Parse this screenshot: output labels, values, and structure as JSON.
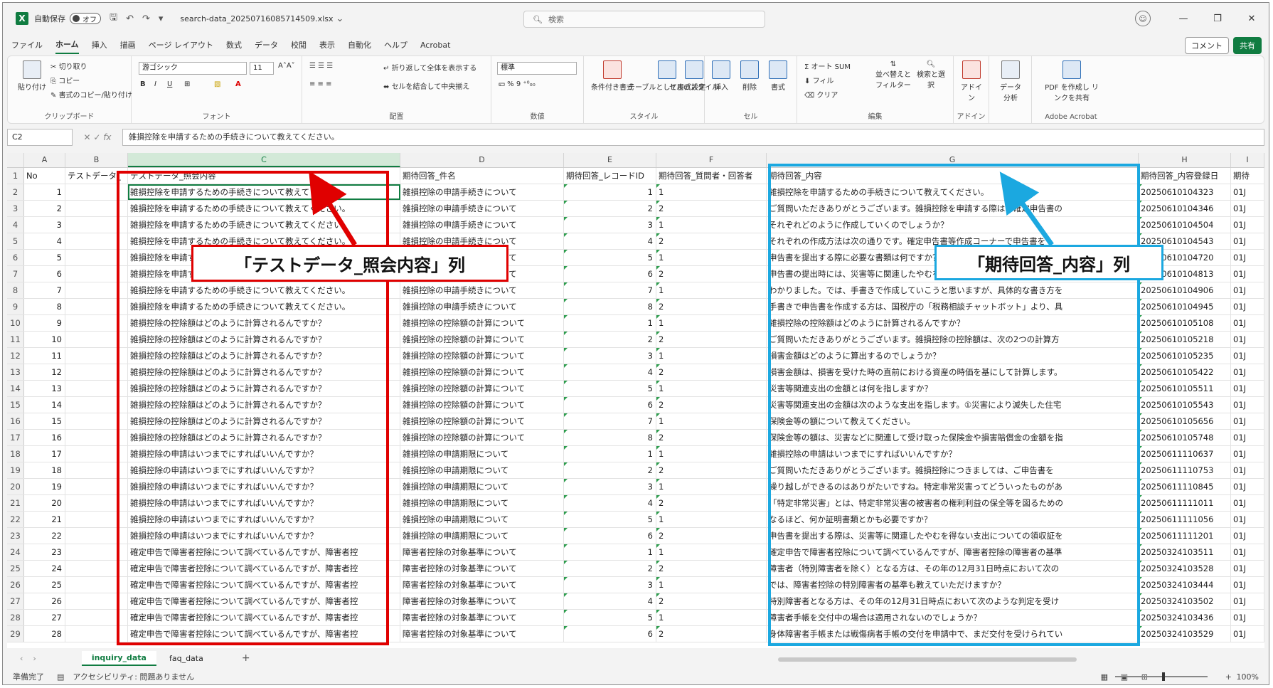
{
  "titlebar": {
    "autosave_label": "自動保存",
    "autosave_state": "オフ",
    "filename": "search-data_20250716085714509.xlsx",
    "search_placeholder": "検索"
  },
  "menu": [
    "ファイル",
    "ホーム",
    "挿入",
    "描画",
    "ページ レイアウト",
    "数式",
    "データ",
    "校閲",
    "表示",
    "自動化",
    "ヘルプ",
    "Acrobat"
  ],
  "menu_active": "ホーム",
  "menu_right": {
    "comment": "コメント",
    "share": "共有"
  },
  "ribbon": {
    "clipboard": {
      "label": "クリップボード",
      "paste": "貼り付け",
      "cut": "切り取り",
      "copy": "コピー",
      "format_painter": "書式のコピー/貼り付け"
    },
    "font": {
      "label": "フォント",
      "name": "游ゴシック",
      "size": "11"
    },
    "alignment": {
      "label": "配置",
      "wrap": "折り返して全体を表示する",
      "merge": "セルを結合して中央揃え"
    },
    "number": {
      "label": "数値",
      "format": "標準"
    },
    "styles": {
      "label": "スタイル",
      "cond": "条件付き書式",
      "table": "テーブルとして書式設定",
      "cell": "セルのスタイル"
    },
    "cells": {
      "label": "セル",
      "insert": "挿入",
      "delete": "削除",
      "format": "書式"
    },
    "editing": {
      "label": "編集",
      "autosum": "オート SUM",
      "fill": "フィル",
      "clear": "クリア",
      "sort": "並べ替えとフィルター",
      "find": "検索と選択"
    },
    "addins": {
      "label": "アドイン",
      "addin": "アドイン"
    },
    "analysis": {
      "label": "",
      "analyze": "データ分析"
    },
    "acrobat": {
      "label": "Adobe Acrobat",
      "pdf": "PDF を作成し リンクを共有"
    }
  },
  "formula_bar": {
    "namebox": "C2",
    "formula": "雑損控除を申請するための手続きについて教えてください。"
  },
  "columns": [
    "A",
    "B",
    "C",
    "D",
    "E",
    "F",
    "G",
    "H",
    "I"
  ],
  "header_row": [
    "No",
    "テストデータ_",
    "テストデータ_照会内容",
    "期待回答_件名",
    "期待回答_レコードID",
    "期待回答_質問者・回答者",
    "期待回答_内容",
    "期待回答_内容登録日",
    "期待"
  ],
  "rows": [
    {
      "no": "1",
      "c": "雑損控除を申請するための手続きについて教えてください。",
      "d": "雑損控除の申請手続きについて",
      "e": "1",
      "f": "1",
      "g": "雑損控除を申請するための手続きについて教えてください。",
      "h": "20250610104323",
      "i": "01J"
    },
    {
      "no": "2",
      "c": "雑損控除を申請するための手続きについて教えてください。",
      "d": "雑損控除の申請手続きについて",
      "e": "2",
      "f": "2",
      "g": "ご質問いただきありがとうございます。雑損控除を申請する際は、確定申告書の",
      "h": "20250610104346",
      "i": "01J"
    },
    {
      "no": "3",
      "c": "雑損控除を申請するための手続きについて教えてください。",
      "d": "雑損控除の申請手続きについて",
      "e": "3",
      "f": "1",
      "g": "それぞれどのように作成していくのでしょうか？",
      "h": "20250610104504",
      "i": "01J"
    },
    {
      "no": "4",
      "c": "雑損控除を申請するための手続きについて教えてください。",
      "d": "雑損控除の申請手続きについて",
      "e": "4",
      "f": "2",
      "g": "それぞれの作成方法は次の通りです。確定申告書等作成コーナーで申告書を",
      "h": "20250610104543",
      "i": "01J"
    },
    {
      "no": "5",
      "c": "雑損控除を申請するための手続きについて教えてください。",
      "d": "雑損控除の申請手続きについて",
      "e": "5",
      "f": "1",
      "g": "申告書を提出する際に必要な書類は何ですか？",
      "h": "20250610104720",
      "i": "01J"
    },
    {
      "no": "6",
      "c": "雑損控除を申請するための手続きについて教えてください。",
      "d": "雑損控除の申請手続きについて",
      "e": "6",
      "f": "2",
      "g": "申告書の提出時には、災害等に関連したやむを得ない支出の",
      "h": "20250610104813",
      "i": "01J"
    },
    {
      "no": "7",
      "c": "雑損控除を申請するための手続きについて教えてください。",
      "d": "雑損控除の申請手続きについて",
      "e": "7",
      "f": "1",
      "g": "わかりました。では、手書きで作成していこうと思いますが、具体的な書き方を",
      "h": "20250610104906",
      "i": "01J"
    },
    {
      "no": "8",
      "c": "雑損控除を申請するための手続きについて教えてください。",
      "d": "雑損控除の申請手続きについて",
      "e": "8",
      "f": "2",
      "g": "手書きで申告書を作成する方は、国税庁の「税務相談チャットボット」より、具",
      "h": "20250610104945",
      "i": "01J"
    },
    {
      "no": "9",
      "c": "雑損控除の控除額はどのように計算されるんですか？",
      "d": "雑損控除の控除額の計算について",
      "e": "1",
      "f": "1",
      "g": "雑損控除の控除額はどのように計算されるんですか？",
      "h": "20250610105108",
      "i": "01J"
    },
    {
      "no": "10",
      "c": "雑損控除の控除額はどのように計算されるんですか？",
      "d": "雑損控除の控除額の計算について",
      "e": "2",
      "f": "2",
      "g": "ご質問いただきありがとうございます。雑損控除の控除額は、次の2つの計算方",
      "h": "20250610105218",
      "i": "01J"
    },
    {
      "no": "11",
      "c": "雑損控除の控除額はどのように計算されるんですか？",
      "d": "雑損控除の控除額の計算について",
      "e": "3",
      "f": "1",
      "g": "損害金額はどのように算出するのでしょうか？",
      "h": "20250610105235",
      "i": "01J"
    },
    {
      "no": "12",
      "c": "雑損控除の控除額はどのように計算されるんですか？",
      "d": "雑損控除の控除額の計算について",
      "e": "4",
      "f": "2",
      "g": "損害金額は、損害を受けた時の直前における資産の時価を基にして計算します。",
      "h": "20250610105422",
      "i": "01J"
    },
    {
      "no": "13",
      "c": "雑損控除の控除額はどのように計算されるんですか？",
      "d": "雑損控除の控除額の計算について",
      "e": "5",
      "f": "1",
      "g": "災害等関連支出の金額とは何を指しますか？",
      "h": "20250610105511",
      "i": "01J"
    },
    {
      "no": "14",
      "c": "雑損控除の控除額はどのように計算されるんですか？",
      "d": "雑損控除の控除額の計算について",
      "e": "6",
      "f": "2",
      "g": "災害等関連支出の金額は次のような支出を指します。①災害により滅失した住宅",
      "h": "20250610105543",
      "i": "01J"
    },
    {
      "no": "15",
      "c": "雑損控除の控除額はどのように計算されるんですか？",
      "d": "雑損控除の控除額の計算について",
      "e": "7",
      "f": "1",
      "g": "保険金等の額について教えてください。",
      "h": "20250610105656",
      "i": "01J"
    },
    {
      "no": "16",
      "c": "雑損控除の控除額はどのように計算されるんですか？",
      "d": "雑損控除の控除額の計算について",
      "e": "8",
      "f": "2",
      "g": "保険金等の額は、災害などに関連して受け取った保険金や損害賠償金の金額を指",
      "h": "20250610105748",
      "i": "01J"
    },
    {
      "no": "17",
      "c": "雑損控除の申請はいつまでにすればいいんですか？",
      "d": "雑損控除の申請期限について",
      "e": "1",
      "f": "1",
      "g": "雑損控除の申請はいつまでにすればいいんですか？",
      "h": "20250611110637",
      "i": "01J"
    },
    {
      "no": "18",
      "c": "雑損控除の申請はいつまでにすればいいんですか？",
      "d": "雑損控除の申請期限について",
      "e": "2",
      "f": "2",
      "g": "ご質問いただきありがとうございます。雑損控除につきましては、ご申告書を",
      "h": "20250611110753",
      "i": "01J"
    },
    {
      "no": "19",
      "c": "雑損控除の申請はいつまでにすればいいんですか？",
      "d": "雑損控除の申請期限について",
      "e": "3",
      "f": "1",
      "g": "繰り越しができるのはありがたいですね。特定非常災害ってどういったものがあ",
      "h": "20250611110845",
      "i": "01J"
    },
    {
      "no": "20",
      "c": "雑損控除の申請はいつまでにすればいいんですか？",
      "d": "雑損控除の申請期限について",
      "e": "4",
      "f": "2",
      "g": "「特定非常災害」とは、特定非常災害の被害者の権利利益の保全等を図るための",
      "h": "20250611111011",
      "i": "01J"
    },
    {
      "no": "21",
      "c": "雑損控除の申請はいつまでにすればいいんですか？",
      "d": "雑損控除の申請期限について",
      "e": "5",
      "f": "1",
      "g": "なるほど、何か証明書類とかも必要ですか？",
      "h": "20250611111056",
      "i": "01J"
    },
    {
      "no": "22",
      "c": "雑損控除の申請はいつまでにすればいいんですか？",
      "d": "雑損控除の申請期限について",
      "e": "6",
      "f": "2",
      "g": "申告書を提出する際は、災害等に関連したやむを得ない支出についての領収証を",
      "h": "20250611111201",
      "i": "01J"
    },
    {
      "no": "23",
      "c": "確定申告で障害者控除について調べているんですが、障害者控",
      "d": "障害者控除の対象基準について",
      "e": "1",
      "f": "1",
      "g": "確定申告で障害者控除について調べているんですが、障害者控除の障害者の基準",
      "h": "20250324103511",
      "i": "01J"
    },
    {
      "no": "24",
      "c": "確定申告で障害者控除について調べているんですが、障害者控",
      "d": "障害者控除の対象基準について",
      "e": "2",
      "f": "2",
      "g": "障害者（特別障害者を除く）となる方は、その年の12月31日時点において次の",
      "h": "20250324103528",
      "i": "01J"
    },
    {
      "no": "25",
      "c": "確定申告で障害者控除について調べているんですが、障害者控",
      "d": "障害者控除の対象基準について",
      "e": "3",
      "f": "1",
      "g": "では、障害者控除の特別障害者の基準も教えていただけますか？",
      "h": "20250324103444",
      "i": "01J"
    },
    {
      "no": "26",
      "c": "確定申告で障害者控除について調べているんですが、障害者控",
      "d": "障害者控除の対象基準について",
      "e": "4",
      "f": "2",
      "g": "特別障害者となる方は、その年の12月31日時点において次のような判定を受け",
      "h": "20250324103502",
      "i": "01J"
    },
    {
      "no": "27",
      "c": "確定申告で障害者控除について調べているんですが、障害者控",
      "d": "障害者控除の対象基準について",
      "e": "5",
      "f": "1",
      "g": "障害者手帳を交付中の場合は適用されないのでしょうか？",
      "h": "20250324103436",
      "i": "01J"
    },
    {
      "no": "28",
      "c": "確定申告で障害者控除について調べているんですが、障害者控",
      "d": "障害者控除の対象基準について",
      "e": "6",
      "f": "2",
      "g": "身体障害者手帳または戦傷病者手帳の交付を申請中で、まだ交付を受けられてい",
      "h": "20250324103529",
      "i": "01J"
    }
  ],
  "annotations": {
    "red": "「テストデータ_照会内容」列",
    "blue": "「期待回答_内容」列"
  },
  "sheets": [
    "inquiry_data",
    "faq_data"
  ],
  "status": {
    "ready": "準備完了",
    "accessibility": "アクセシビリティ: 問題ありません",
    "zoom": "100%"
  }
}
